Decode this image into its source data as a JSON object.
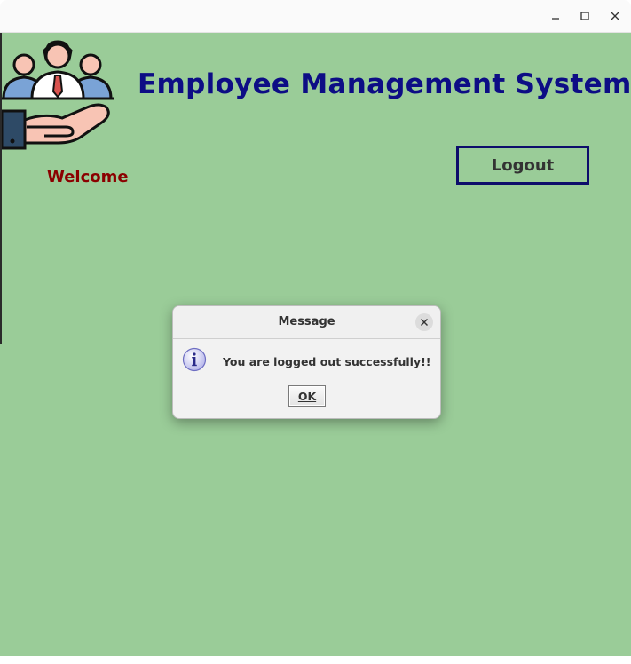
{
  "window": {
    "controls": {
      "minimize_icon": "minimize-icon",
      "maximize_icon": "maximize-icon",
      "close_icon": "close-icon"
    }
  },
  "app": {
    "title": "Employee Management System",
    "welcome_text": "Welcome",
    "logout_label": "Logout",
    "logo_icon": "employee-management-logo",
    "colors": {
      "background": "#9acc98",
      "title": "#0d0d85",
      "welcome": "#8b0000",
      "logout_border": "#0d0d6b"
    }
  },
  "dialog": {
    "title": "Message",
    "message": "You are logged out successfully!!",
    "ok_label": "OK",
    "icon": "info-icon",
    "close_icon": "close-icon"
  }
}
